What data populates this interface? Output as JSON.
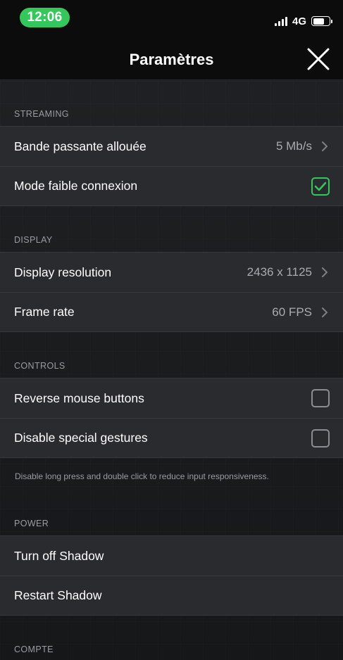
{
  "status_bar": {
    "time": "12:06",
    "network": "4G"
  },
  "nav": {
    "title": "Paramètres",
    "close_icon": "close-icon"
  },
  "sections": {
    "streaming": {
      "header": "STREAMING",
      "bandwidth": {
        "label": "Bande passante allouée",
        "value": "5 Mb/s"
      },
      "low_connection": {
        "label": "Mode faible connexion",
        "checked": true
      }
    },
    "display": {
      "header": "DISPLAY",
      "resolution": {
        "label": "Display resolution",
        "value": "2436 x 1125"
      },
      "frame_rate": {
        "label": "Frame rate",
        "value": "60 FPS"
      }
    },
    "controls": {
      "header": "CONTROLS",
      "reverse_mouse": {
        "label": "Reverse mouse buttons",
        "checked": false
      },
      "disable_gestures": {
        "label": "Disable special gestures",
        "checked": false
      },
      "footnote": "Disable long press and double click to reduce input responsiveness."
    },
    "power": {
      "header": "POWER",
      "turn_off": {
        "label": "Turn off Shadow"
      },
      "restart": {
        "label": "Restart Shadow"
      }
    },
    "account": {
      "header": "COMPTE"
    }
  },
  "colors": {
    "accent_green": "#34c759",
    "background": "#1c1d1f",
    "row_background": "#2a2b2e",
    "secondary_text": "#9a9ca1"
  }
}
